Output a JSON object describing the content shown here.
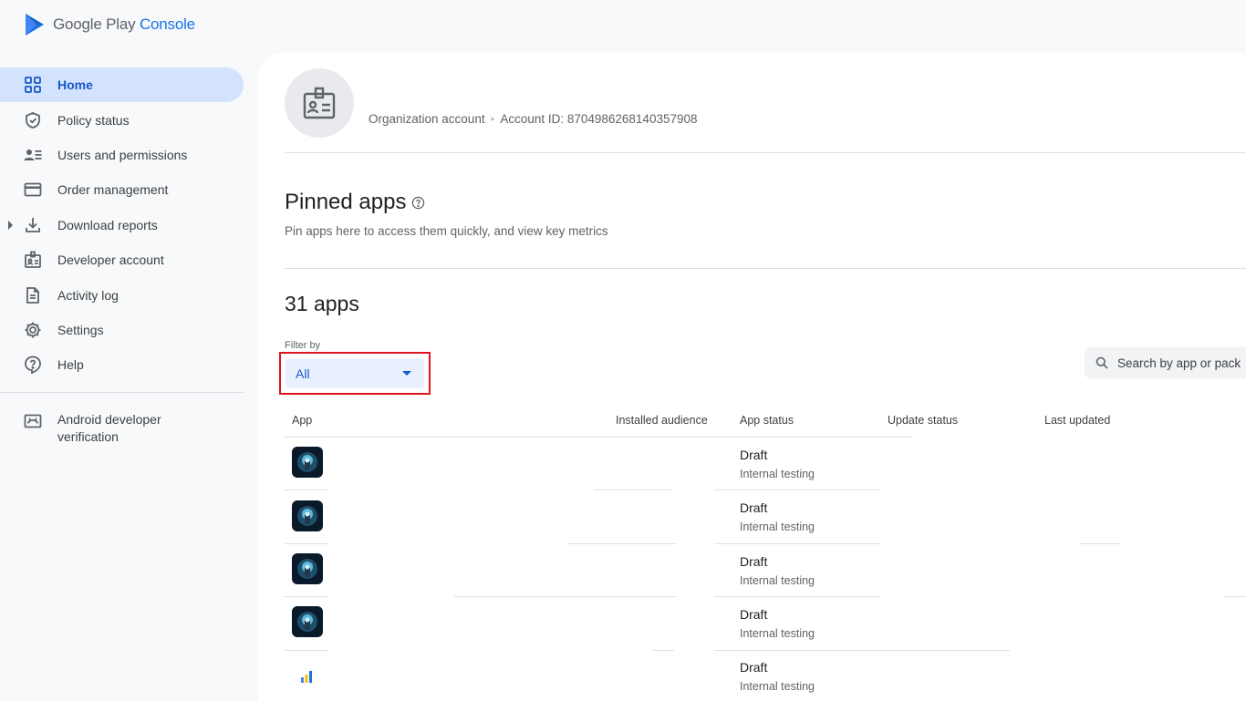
{
  "brand": {
    "name_prefix": "Google Play ",
    "name_accent": "Console"
  },
  "sidebar": {
    "items": [
      {
        "label": "Home",
        "icon": "dashboard-grid-icon",
        "active": true
      },
      {
        "label": "Policy status",
        "icon": "shield-icon"
      },
      {
        "label": "Users and permissions",
        "icon": "users-list-icon"
      },
      {
        "label": "Order management",
        "icon": "credit-card-icon"
      },
      {
        "label": "Download reports",
        "icon": "download-icon",
        "expandable": true
      },
      {
        "label": "Developer account",
        "icon": "badge-icon"
      },
      {
        "label": "Activity log",
        "icon": "document-icon"
      },
      {
        "label": "Settings",
        "icon": "gear-icon"
      },
      {
        "label": "Help",
        "icon": "help-icon"
      }
    ],
    "extra": {
      "label_line1": "Android developer",
      "label_line2": "verification",
      "icon": "verification-card-icon"
    }
  },
  "account": {
    "type": "Organization account",
    "id_text": "Account ID: 8704986268140357908"
  },
  "pinned": {
    "title": "Pinned apps",
    "subtitle": "Pin apps here to access them quickly, and view key metrics"
  },
  "apps": {
    "count_label": "31 apps",
    "filter_label": "Filter by",
    "filter_value": "All",
    "search_placeholder": "Search by app or pack",
    "columns": [
      "App",
      "Installed audience",
      "App status",
      "Update status",
      "Last updated"
    ],
    "rows": [
      {
        "icon": "dark-app-icon",
        "status": "Draft",
        "substatus": "Internal testing"
      },
      {
        "icon": "dark-app-icon",
        "status": "Draft",
        "substatus": "Internal testing"
      },
      {
        "icon": "dark-app-icon",
        "status": "Draft",
        "substatus": "Internal testing"
      },
      {
        "icon": "dark-app-icon",
        "status": "Draft",
        "substatus": "Internal testing"
      },
      {
        "icon": "bar-chart-app-icon",
        "status": "Draft",
        "substatus": "Internal testing"
      }
    ]
  },
  "colors": {
    "accent": "#1a73e8",
    "active_nav_bg": "#d3e3fd",
    "highlight_border": "#e0141e"
  }
}
